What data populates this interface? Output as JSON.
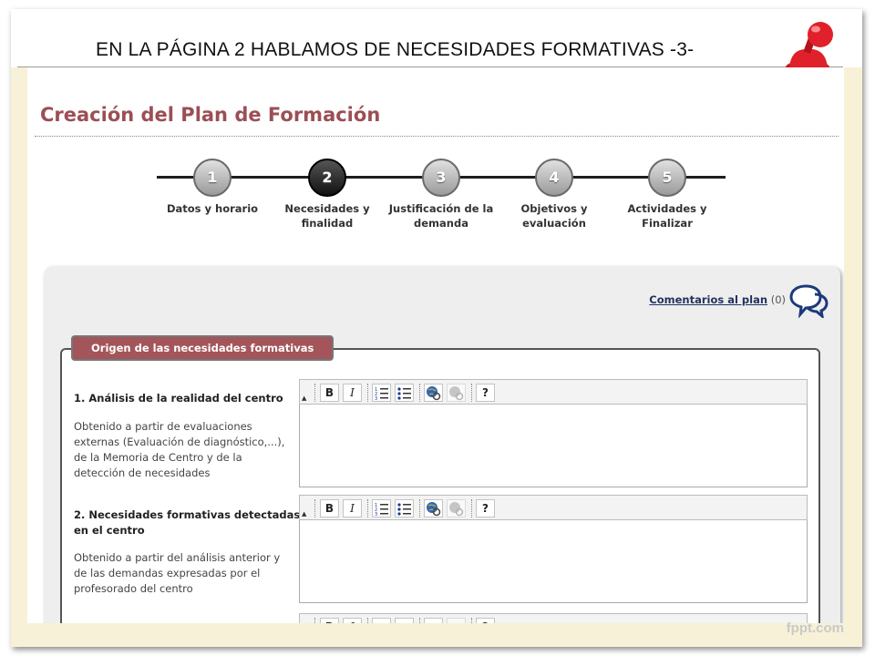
{
  "slide": {
    "title": "EN LA PÁGINA 2 HABLAMOS DE NECESIDADES FORMATIVAS   -3-",
    "watermark": "fppt.com"
  },
  "page": {
    "title": "Creación del Plan de Formación"
  },
  "steps": [
    {
      "number": "1",
      "label_line1": "Datos y horario",
      "label_line2": "",
      "active": false
    },
    {
      "number": "2",
      "label_line1": "Necesidades y",
      "label_line2": "finalidad",
      "active": true
    },
    {
      "number": "3",
      "label_line1": "Justificación de la",
      "label_line2": "demanda",
      "active": false
    },
    {
      "number": "4",
      "label_line1": "Objetivos y",
      "label_line2": "evaluación",
      "active": false
    },
    {
      "number": "5",
      "label_line1": "Actividades y",
      "label_line2": "Finalizar",
      "active": false
    }
  ],
  "comments": {
    "link_label": "Comentarios al plan",
    "count": "(0)"
  },
  "section": {
    "legend": "Origen de las necesidades formativas",
    "questions": [
      {
        "title_line1": "1. Análisis de la realidad del centro",
        "title_line2": "",
        "desc": [
          "Obtenido a partir de evaluaciones",
          "externas (Evaluación de diagnóstico,...),",
          "de la Memoria de Centro y de la",
          "detección de necesidades"
        ]
      },
      {
        "title_line1": "2. Necesidades formativas detectadas",
        "title_line2": "en el centro",
        "desc": [
          "Obtenido a partir del análisis anterior y",
          "de las demandas expresadas por el",
          "profesorado del centro"
        ]
      }
    ]
  },
  "toolbar": {
    "bold": "B",
    "italic": "I",
    "help": "?"
  },
  "icons": {
    "pin": "red-pushpin-icon",
    "chat": "speech-bubbles-icon",
    "ordered_list": "ordered-list-icon",
    "unordered_list": "unordered-list-icon",
    "link": "link-icon",
    "unlink": "unlink-icon",
    "help": "help-icon"
  },
  "colors": {
    "slide_bg": "#f7f1d8",
    "page_title": "#9b4f55",
    "legend_bg": "#a3555a",
    "link": "#23325e",
    "pin": "#e0212b"
  }
}
